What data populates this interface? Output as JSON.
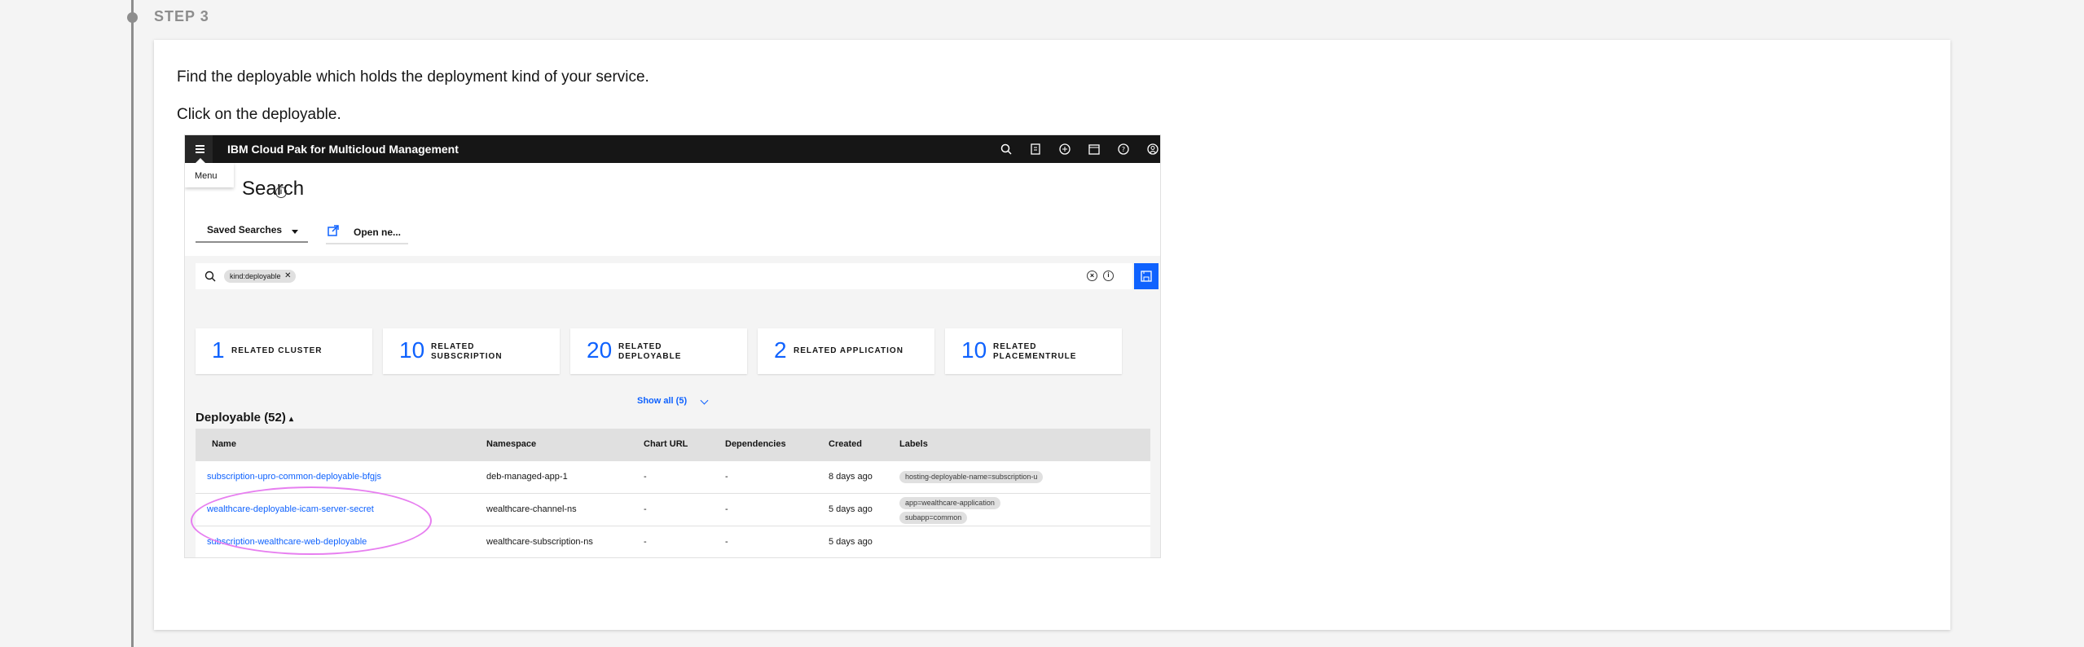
{
  "step": {
    "label": "STEP 3"
  },
  "instructions": {
    "line1": "Find the deployable which holds the deployment kind of your service.",
    "line2": "Click on the deployable."
  },
  "screenshot": {
    "app_title": "IBM Cloud Pak for Multicloud Management",
    "menu_tooltip": "Menu",
    "page_title": "Search",
    "saved_searches": "Saved Searches",
    "open_new": "Open ne...",
    "search_chip": "kind:deployable",
    "tiles": [
      {
        "count": "1",
        "label_line1": "RELATED CLUSTER",
        "label_line2": ""
      },
      {
        "count": "10",
        "label_line1": "RELATED",
        "label_line2": "SUBSCRIPTION"
      },
      {
        "count": "20",
        "label_line1": "RELATED",
        "label_line2": "DEPLOYABLE"
      },
      {
        "count": "2",
        "label_line1": "RELATED APPLICATION",
        "label_line2": ""
      },
      {
        "count": "10",
        "label_line1": "RELATED",
        "label_line2": "PLACEMENTRULE"
      }
    ],
    "show_all": "Show all (5)",
    "section_title": "Deployable (52)",
    "columns": [
      "Name",
      "Namespace",
      "Chart URL",
      "Dependencies",
      "Created",
      "Labels"
    ],
    "rows": [
      {
        "name": "subscription-upro-common-deployable-bfgjs",
        "namespace": "deb-managed-app-1",
        "chart_url": "-",
        "dependencies": "-",
        "created": "8 days ago",
        "labels": [
          "hosting-deployable-name=subscription-u"
        ]
      },
      {
        "name": "wealthcare-deployable-icam-server-secret",
        "namespace": "wealthcare-channel-ns",
        "chart_url": "-",
        "dependencies": "-",
        "created": "5 days ago",
        "labels": [
          "app=wealthcare-application",
          "subapp=common"
        ]
      },
      {
        "name": "subscription-wealthcare-web-deployable",
        "namespace": "wealthcare-subscription-ns",
        "chart_url": "-",
        "dependencies": "-",
        "created": "5 days ago",
        "labels": []
      }
    ],
    "colors": {
      "accent": "#0f62fe",
      "topbar": "#161616",
      "highlight": "#e77ff0"
    },
    "icons": [
      "menu-icon",
      "search-icon",
      "document-icon",
      "add-icon",
      "calendar-icon",
      "help-icon",
      "user-icon",
      "info-icon",
      "launch-icon",
      "clear-icon",
      "save-icon",
      "chevron-down-icon"
    ]
  }
}
